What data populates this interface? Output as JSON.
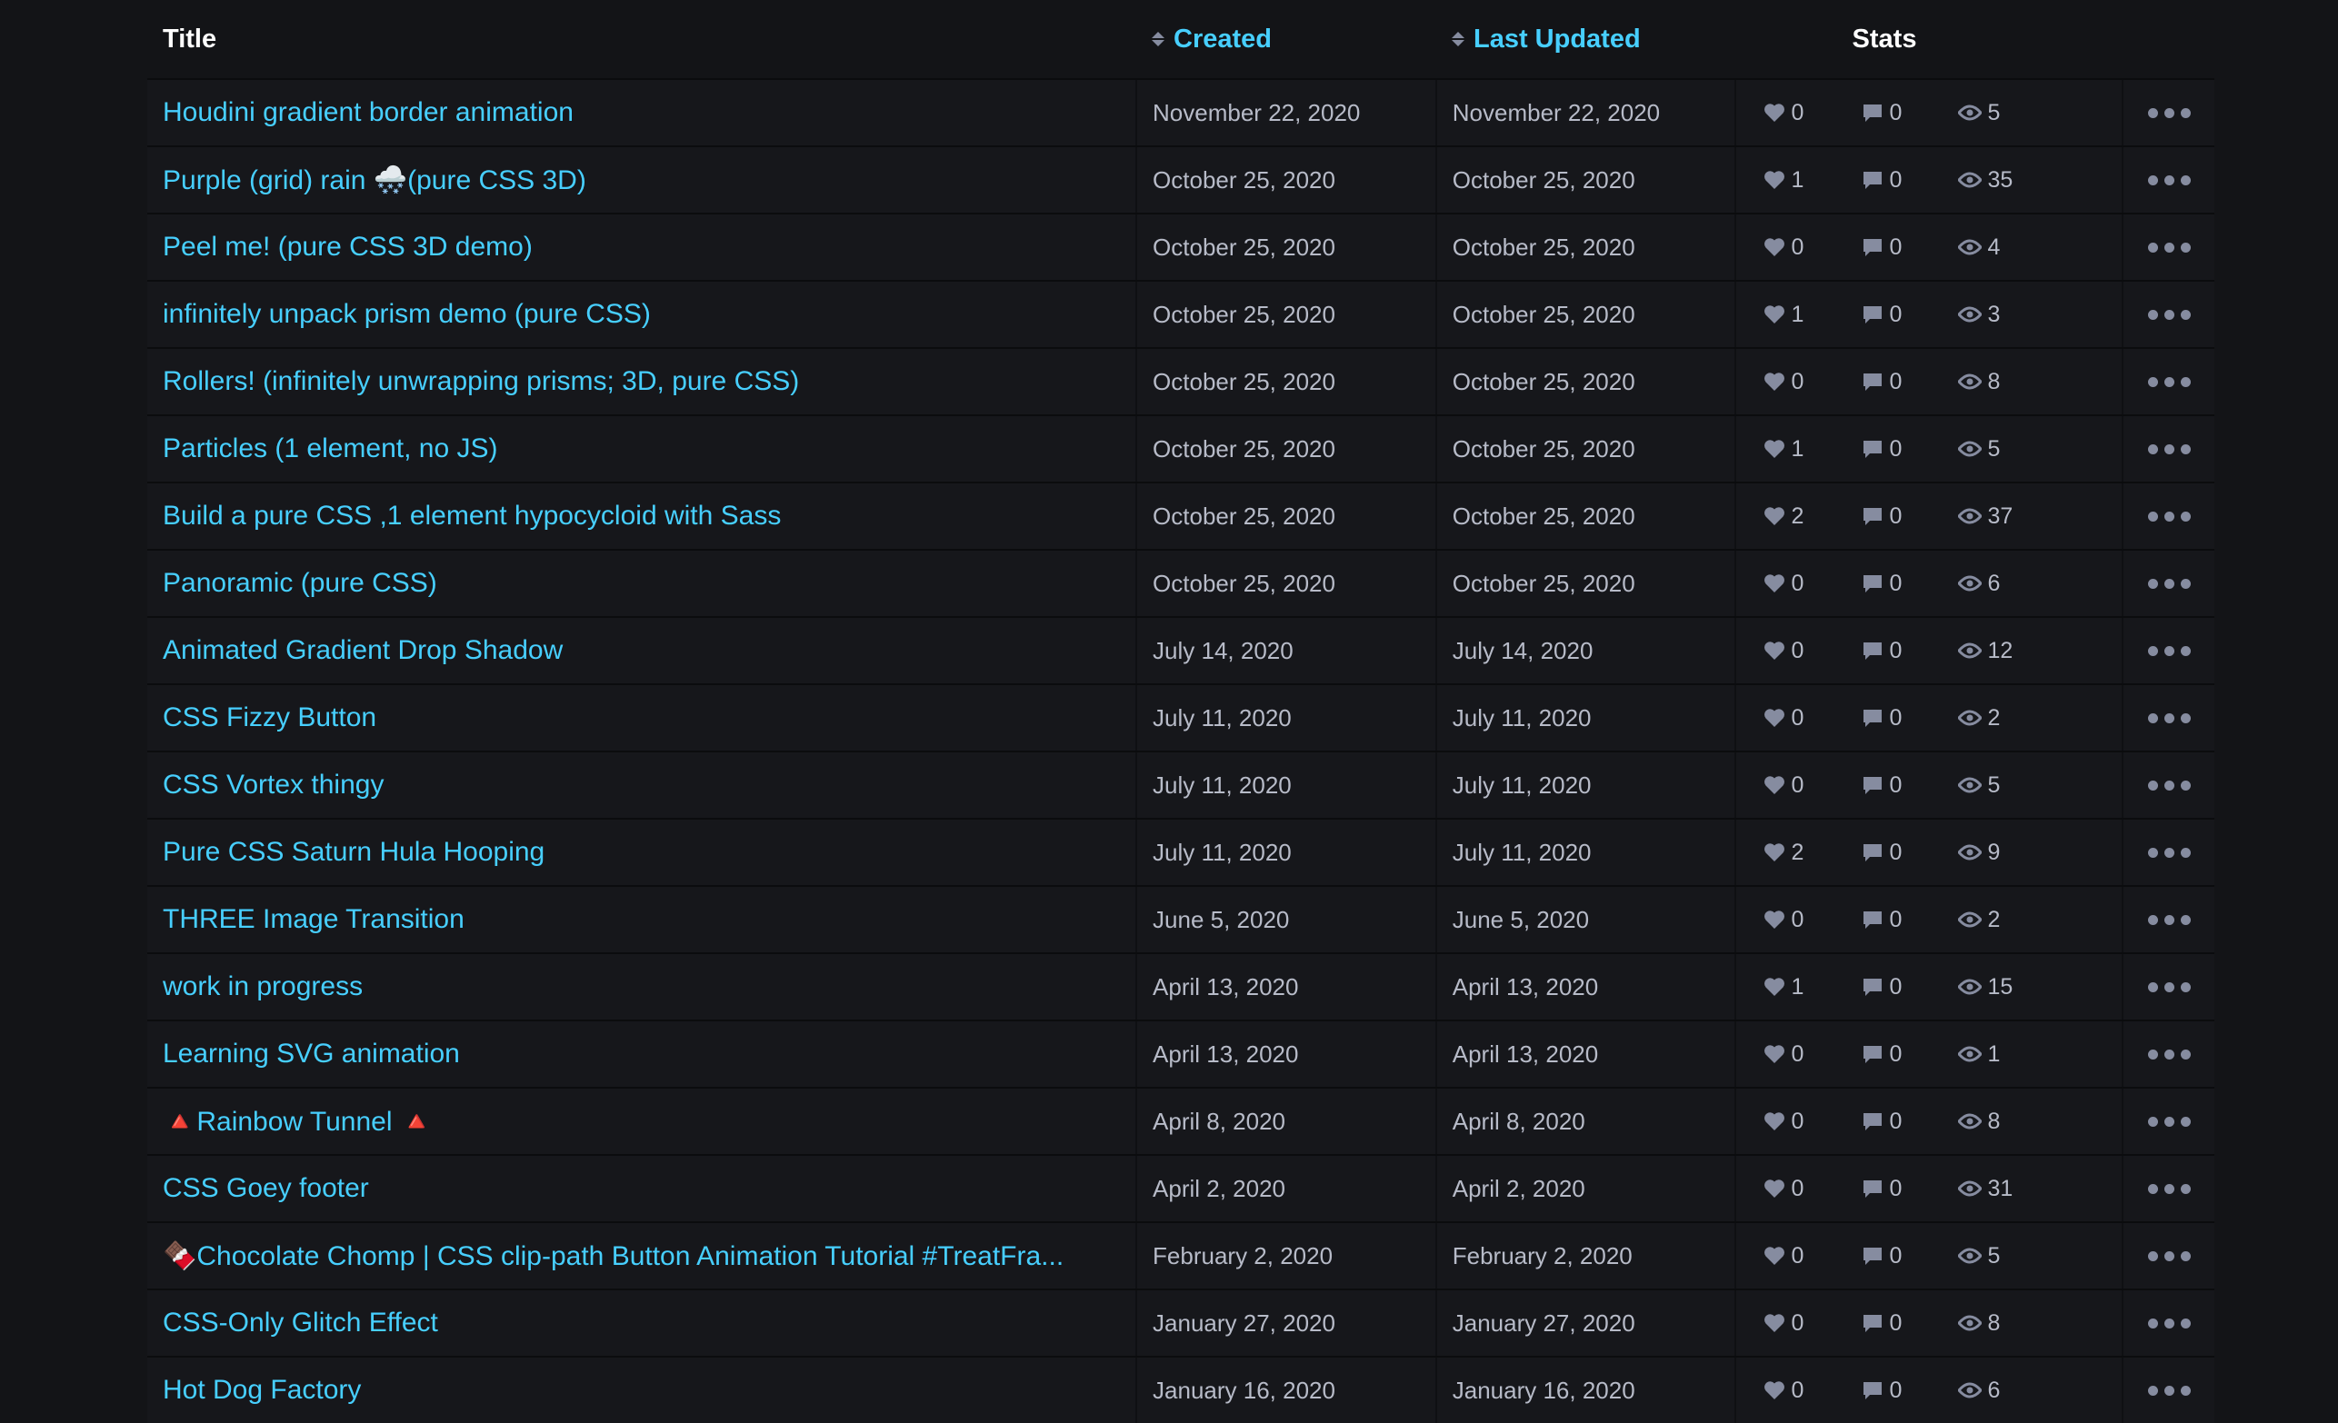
{
  "header": {
    "title": "Title",
    "created": "Created",
    "last_updated": "Last Updated",
    "stats": "Stats"
  },
  "rows": [
    {
      "title": "Houdini gradient border animation",
      "created": "November 22, 2020",
      "updated": "November 22, 2020",
      "hearts": "0",
      "comments": "0",
      "views": "5"
    },
    {
      "title": "Purple (grid) rain 🌨️(pure CSS 3D)",
      "created": "October 25, 2020",
      "updated": "October 25, 2020",
      "hearts": "1",
      "comments": "0",
      "views": "35"
    },
    {
      "title": "Peel me! (pure CSS 3D demo)",
      "created": "October 25, 2020",
      "updated": "October 25, 2020",
      "hearts": "0",
      "comments": "0",
      "views": "4"
    },
    {
      "title": "infinitely unpack prism demo (pure CSS)",
      "created": "October 25, 2020",
      "updated": "October 25, 2020",
      "hearts": "1",
      "comments": "0",
      "views": "3"
    },
    {
      "title": "Rollers! (infinitely unwrapping prisms; 3D, pure CSS)",
      "created": "October 25, 2020",
      "updated": "October 25, 2020",
      "hearts": "0",
      "comments": "0",
      "views": "8"
    },
    {
      "title": "Particles (1 element, no JS)",
      "created": "October 25, 2020",
      "updated": "October 25, 2020",
      "hearts": "1",
      "comments": "0",
      "views": "5"
    },
    {
      "title": "Build a pure CSS ,1 element hypocycloid with Sass",
      "created": "October 25, 2020",
      "updated": "October 25, 2020",
      "hearts": "2",
      "comments": "0",
      "views": "37"
    },
    {
      "title": "Panoramic (pure CSS)",
      "created": "October 25, 2020",
      "updated": "October 25, 2020",
      "hearts": "0",
      "comments": "0",
      "views": "6"
    },
    {
      "title": "Animated Gradient Drop Shadow",
      "created": "July 14, 2020",
      "updated": "July 14, 2020",
      "hearts": "0",
      "comments": "0",
      "views": "12"
    },
    {
      "title": "CSS Fizzy Button",
      "created": "July 11, 2020",
      "updated": "July 11, 2020",
      "hearts": "0",
      "comments": "0",
      "views": "2"
    },
    {
      "title": "CSS Vortex thingy",
      "created": "July 11, 2020",
      "updated": "July 11, 2020",
      "hearts": "0",
      "comments": "0",
      "views": "5"
    },
    {
      "title": "Pure CSS Saturn Hula Hooping",
      "created": "July 11, 2020",
      "updated": "July 11, 2020",
      "hearts": "2",
      "comments": "0",
      "views": "9"
    },
    {
      "title": "THREE Image Transition",
      "created": "June 5, 2020",
      "updated": "June 5, 2020",
      "hearts": "0",
      "comments": "0",
      "views": "2"
    },
    {
      "title": "work in progress",
      "created": "April 13, 2020",
      "updated": "April 13, 2020",
      "hearts": "1",
      "comments": "0",
      "views": "15"
    },
    {
      "title": "Learning SVG animation",
      "created": "April 13, 2020",
      "updated": "April 13, 2020",
      "hearts": "0",
      "comments": "0",
      "views": "1"
    },
    {
      "title": "🔺Rainbow Tunnel 🔺",
      "created": "April 8, 2020",
      "updated": "April 8, 2020",
      "hearts": "0",
      "comments": "0",
      "views": "8"
    },
    {
      "title": "CSS Goey footer",
      "created": "April 2, 2020",
      "updated": "April 2, 2020",
      "hearts": "0",
      "comments": "0",
      "views": "31"
    },
    {
      "title": "🍫Chocolate Chomp | CSS clip-path Button Animation Tutorial #TreatFra...",
      "created": "February 2, 2020",
      "updated": "February 2, 2020",
      "hearts": "0",
      "comments": "0",
      "views": "5"
    },
    {
      "title": "CSS-Only Glitch Effect",
      "created": "January 27, 2020",
      "updated": "January 27, 2020",
      "hearts": "0",
      "comments": "0",
      "views": "8"
    },
    {
      "title": "Hot Dog Factory",
      "created": "January 16, 2020",
      "updated": "January 16, 2020",
      "hearts": "0",
      "comments": "0",
      "views": "6"
    }
  ],
  "icons": {
    "heart": "heart-icon",
    "comment": "comment-icon",
    "view": "eye-icon",
    "more": "more-options-icon"
  },
  "colors": {
    "background": "#131417",
    "row_background": "#16171b",
    "link": "#47cfff",
    "muted_text": "#b7bbc8",
    "icon": "#868ca0"
  }
}
